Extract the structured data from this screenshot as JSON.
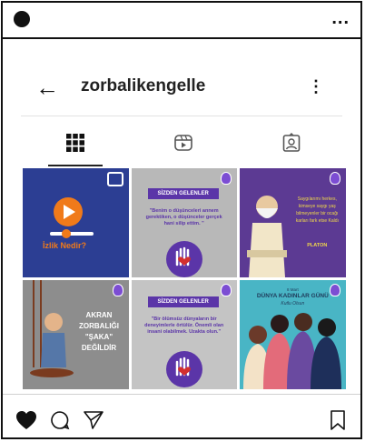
{
  "status": {
    "more_label": "..."
  },
  "profile": {
    "back_glyph": "←",
    "username": "zorbalikengelle",
    "menu_glyph": "⋮"
  },
  "tabs": [
    {
      "name": "grid",
      "icon": "grid-icon",
      "active": true
    },
    {
      "name": "reels",
      "icon": "reels-icon",
      "active": false
    },
    {
      "name": "tagged",
      "icon": "tagged-icon",
      "active": false
    }
  ],
  "posts": [
    {
      "type": "reel",
      "texts": [
        "İzlik Nedir?"
      ],
      "bg": "#2c3e93"
    },
    {
      "type": "post",
      "texts": [
        "SİZDEN GELENLER",
        "\"Benim o düşünceleri annem gerektiken, o düşünceler gerçek hani silip ettim. \""
      ],
      "bg": "#b8b8b8"
    },
    {
      "type": "post",
      "texts": [
        "Saygılarımı herkes, kimseye saygı yaş bilmeyenler bir ocağı karları fark etse Kaldı",
        "PLATON"
      ],
      "bg": "#5c3a93"
    },
    {
      "type": "post",
      "texts": [
        "AKRAN",
        "ZORBALIĞI",
        "\"ŞAKA\"",
        "DEĞİLDİR"
      ],
      "bg": "#8d8d8d"
    },
    {
      "type": "post",
      "texts": [
        "SİZDEN GELENLER",
        "\"Bir ölümsüz dünyaların bir deneyimlerle örtülür. Önemli olan insani olabilmek. Uzakta olun.\""
      ],
      "bg": "#c4c4c4"
    },
    {
      "type": "post",
      "texts": [
        "8 Mart",
        "DÜNYA KADINLAR GÜNÜ",
        "Kutlu Olsun"
      ],
      "bg": "#49b5c5"
    }
  ],
  "colors": {
    "accent_orange": "#f07a1a",
    "brand_purple": "#5b35a8",
    "heart_red": "#d32f2f"
  }
}
